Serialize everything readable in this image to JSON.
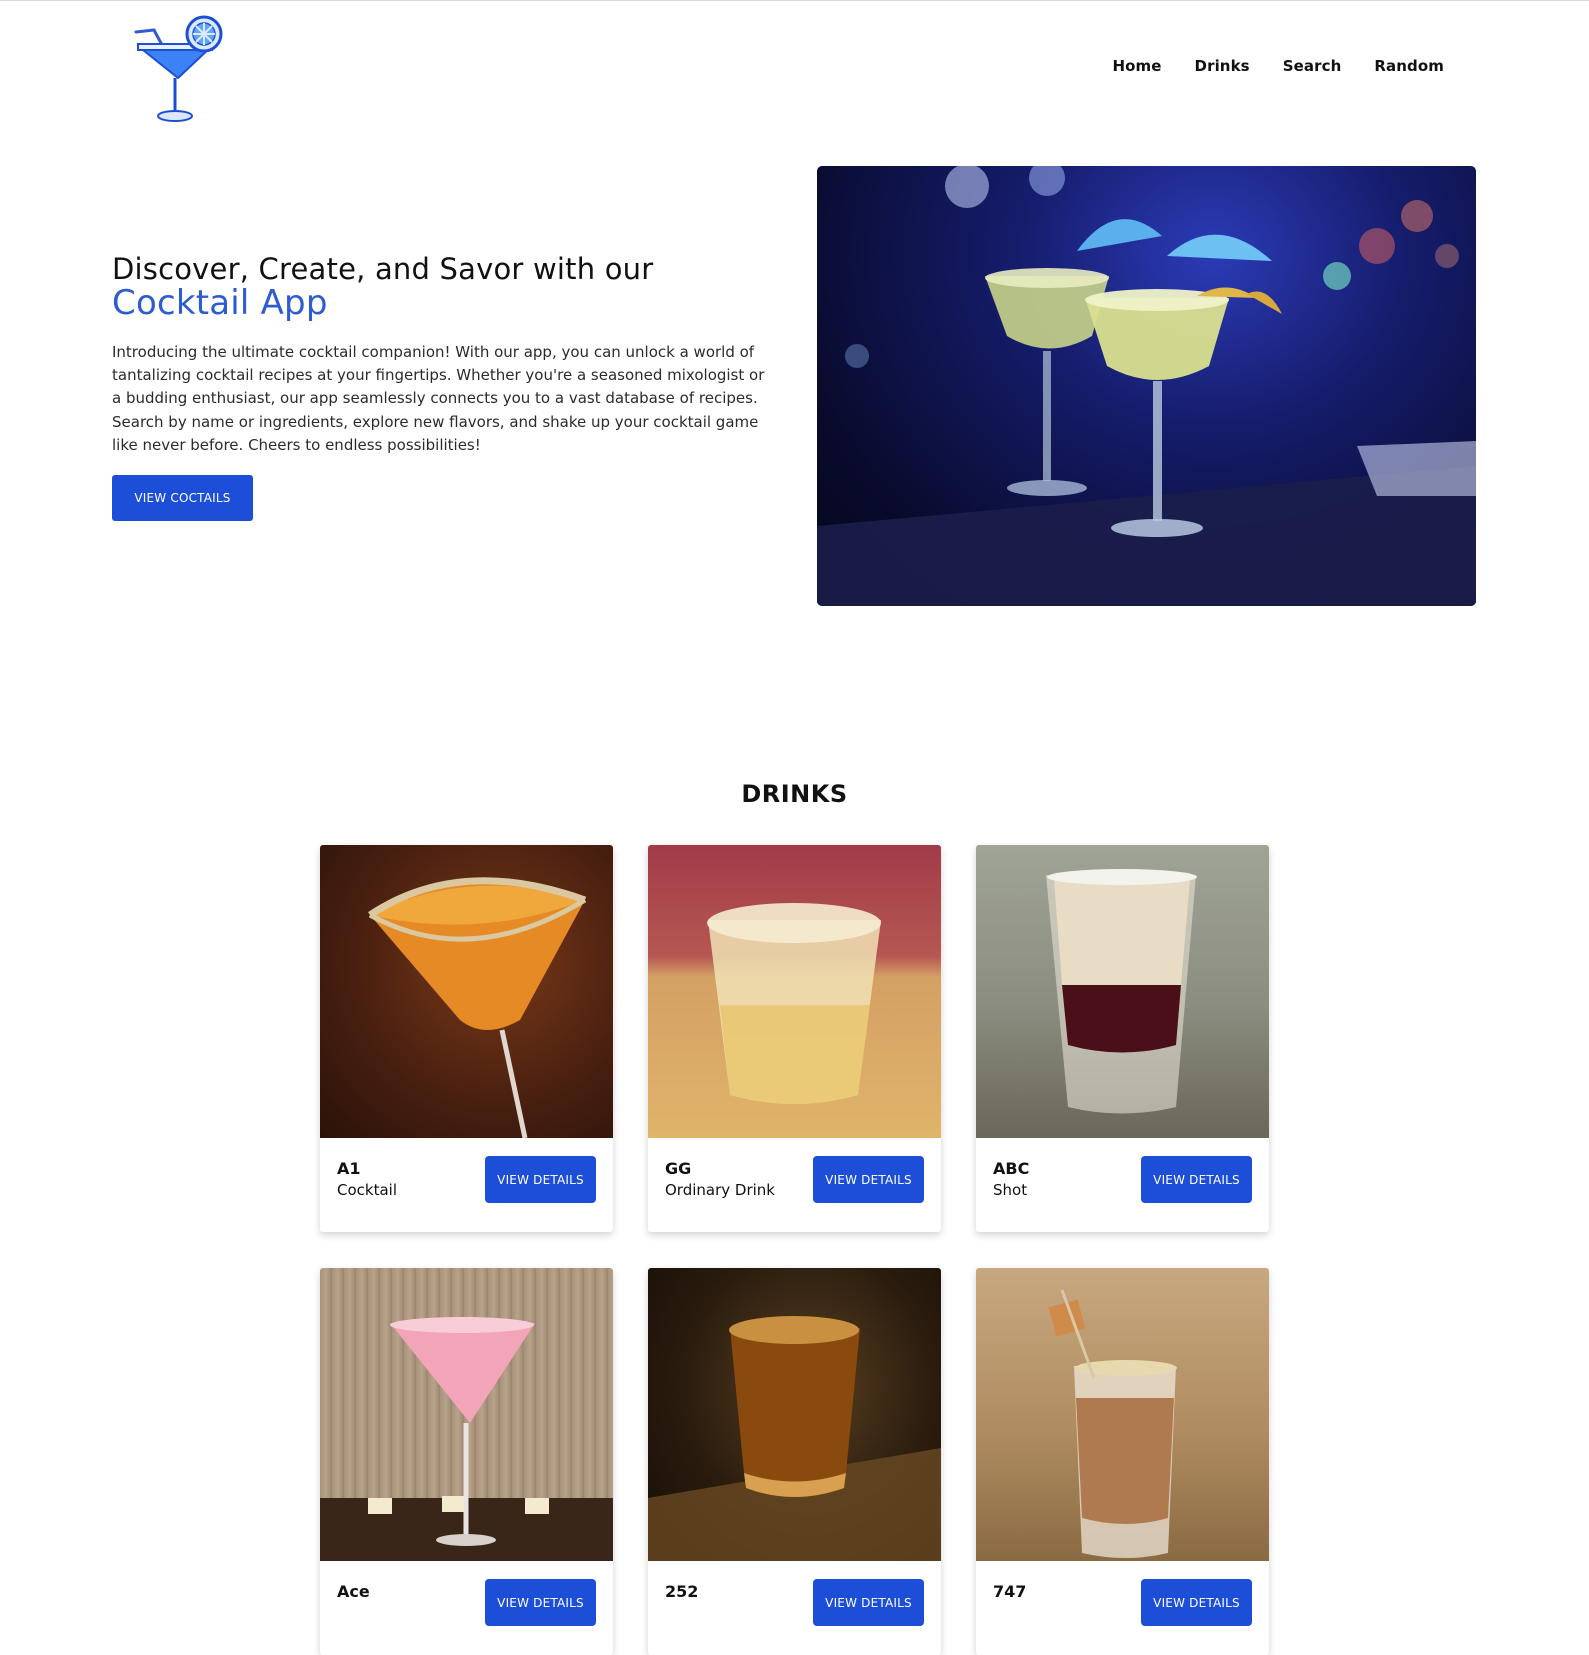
{
  "brand": {
    "logo_icon": "cocktail-glass-icon",
    "accent_color": "#2d5bd2"
  },
  "nav": {
    "items": [
      {
        "label": "Home"
      },
      {
        "label": "Drinks"
      },
      {
        "label": "Search"
      },
      {
        "label": "Random"
      }
    ]
  },
  "hero": {
    "title_prefix": "Discover, Create, and Savor with our ",
    "title_accent": "Cocktail App",
    "description": "Introducing the ultimate cocktail companion! With our app, you can unlock a world of tantalizing cocktail recipes at your fingertips. Whether you're a seasoned mixologist or a budding enthusiast, our app seamlessly connects you to a vast database of recipes. Search by name or ingredients, explore new flavors, and shake up your cocktail game like never before. Cheers to endless possibilities!",
    "button_label": "VIEW COCTAILS",
    "button_color": "#1d4ed8"
  },
  "drinks": {
    "title": "DRINKS",
    "button_label": "VIEW DETAILS",
    "items": [
      {
        "name": "A1",
        "category": "Cocktail"
      },
      {
        "name": "GG",
        "category": "Ordinary Drink"
      },
      {
        "name": "ABC",
        "category": "Shot"
      },
      {
        "name": "Ace",
        "category": ""
      },
      {
        "name": "252",
        "category": ""
      },
      {
        "name": "747",
        "category": ""
      }
    ]
  }
}
